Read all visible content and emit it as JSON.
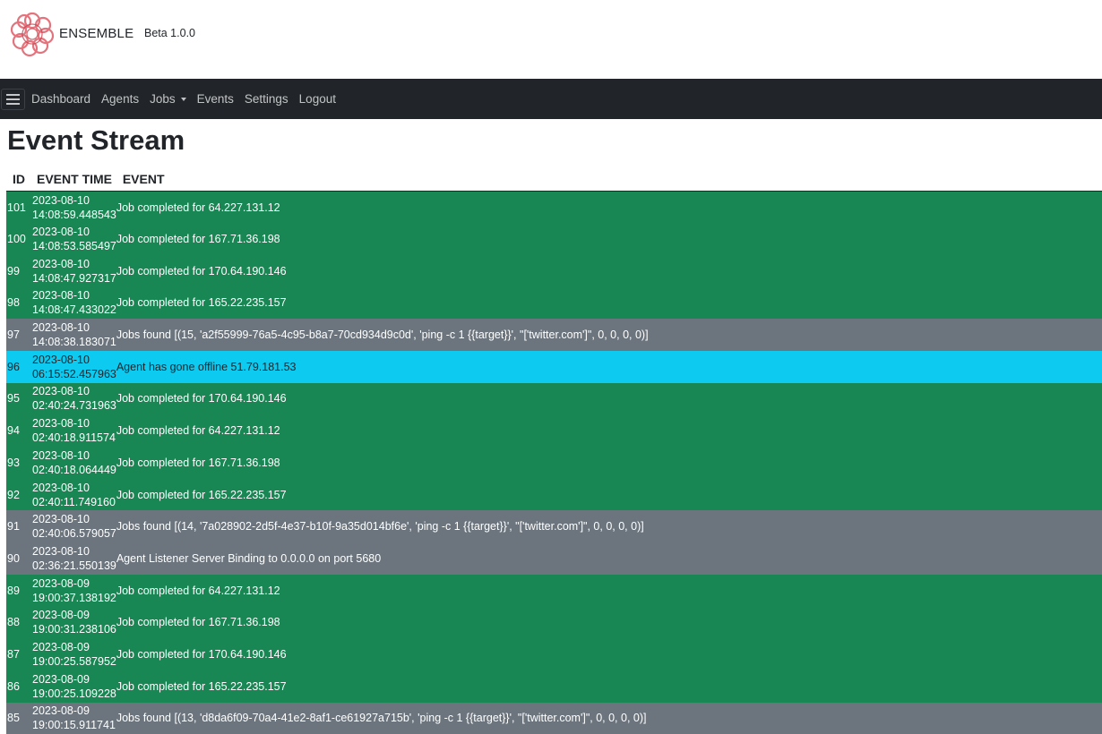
{
  "brand": {
    "name": "ENSEMBLE",
    "version": "Beta 1.0.0",
    "logo_icon": "ensemble-knot-logo",
    "logo_color": "#e0646e"
  },
  "nav": {
    "items": [
      {
        "label": "Dashboard"
      },
      {
        "label": "Agents"
      },
      {
        "label": "Jobs",
        "dropdown": true
      },
      {
        "label": "Events"
      },
      {
        "label": "Settings"
      },
      {
        "label": "Logout"
      }
    ],
    "background": "#212529"
  },
  "page": {
    "title": "Event Stream"
  },
  "table": {
    "headers": [
      "ID",
      "EVENT TIME",
      "EVENT"
    ],
    "row_colors": {
      "success": "#198754",
      "secondary": "#6c757d",
      "info": "#0dcaf0"
    },
    "rows": [
      {
        "id": "101",
        "date": "2023-08-10",
        "time": "14:08:59.448543",
        "event": "Job completed for 64.227.131.12",
        "status": "success"
      },
      {
        "id": "100",
        "date": "2023-08-10",
        "time": "14:08:53.585497",
        "event": "Job completed for 167.71.36.198",
        "status": "success"
      },
      {
        "id": "99",
        "date": "2023-08-10",
        "time": "14:08:47.927317",
        "event": "Job completed for 170.64.190.146",
        "status": "success"
      },
      {
        "id": "98",
        "date": "2023-08-10",
        "time": "14:08:47.433022",
        "event": "Job completed for 165.22.235.157",
        "status": "success"
      },
      {
        "id": "97",
        "date": "2023-08-10",
        "time": "14:08:38.183071",
        "event": "Jobs found [(15, 'a2f55999-76a5-4c95-b8a7-70cd934d9c0d', 'ping -c 1 {{target}}', \"['twitter.com']\", 0, 0, 0, 0)]",
        "status": "secondary"
      },
      {
        "id": "96",
        "date": "2023-08-10",
        "time": "06:15:52.457963",
        "event": "Agent has gone offline 51.79.181.53",
        "status": "info"
      },
      {
        "id": "95",
        "date": "2023-08-10",
        "time": "02:40:24.731963",
        "event": "Job completed for 170.64.190.146",
        "status": "success"
      },
      {
        "id": "94",
        "date": "2023-08-10",
        "time": "02:40:18.911574",
        "event": "Job completed for 64.227.131.12",
        "status": "success"
      },
      {
        "id": "93",
        "date": "2023-08-10",
        "time": "02:40:18.064449",
        "event": "Job completed for 167.71.36.198",
        "status": "success"
      },
      {
        "id": "92",
        "date": "2023-08-10",
        "time": "02:40:11.749160",
        "event": "Job completed for 165.22.235.157",
        "status": "success"
      },
      {
        "id": "91",
        "date": "2023-08-10",
        "time": "02:40:06.579057",
        "event": "Jobs found [(14, '7a028902-2d5f-4e37-b10f-9a35d014bf6e', 'ping -c 1 {{target}}', \"['twitter.com']\", 0, 0, 0, 0)]",
        "status": "secondary"
      },
      {
        "id": "90",
        "date": "2023-08-10",
        "time": "02:36:21.550139",
        "event": "Agent Listener Server Binding to 0.0.0.0 on port 5680",
        "status": "secondary"
      },
      {
        "id": "89",
        "date": "2023-08-09",
        "time": "19:00:37.138192",
        "event": "Job completed for 64.227.131.12",
        "status": "success"
      },
      {
        "id": "88",
        "date": "2023-08-09",
        "time": "19:00:31.238106",
        "event": "Job completed for 167.71.36.198",
        "status": "success"
      },
      {
        "id": "87",
        "date": "2023-08-09",
        "time": "19:00:25.587952",
        "event": "Job completed for 170.64.190.146",
        "status": "success"
      },
      {
        "id": "86",
        "date": "2023-08-09",
        "time": "19:00:25.109228",
        "event": "Job completed for 165.22.235.157",
        "status": "success"
      },
      {
        "id": "85",
        "date": "2023-08-09",
        "time": "19:00:15.911741",
        "event": "Jobs found [(13, 'd8da6f09-70a4-41e2-8af1-ce61927a715b', 'ping -c 1 {{target}}', \"['twitter.com']\", 0, 0, 0, 0)]",
        "status": "secondary"
      }
    ]
  }
}
